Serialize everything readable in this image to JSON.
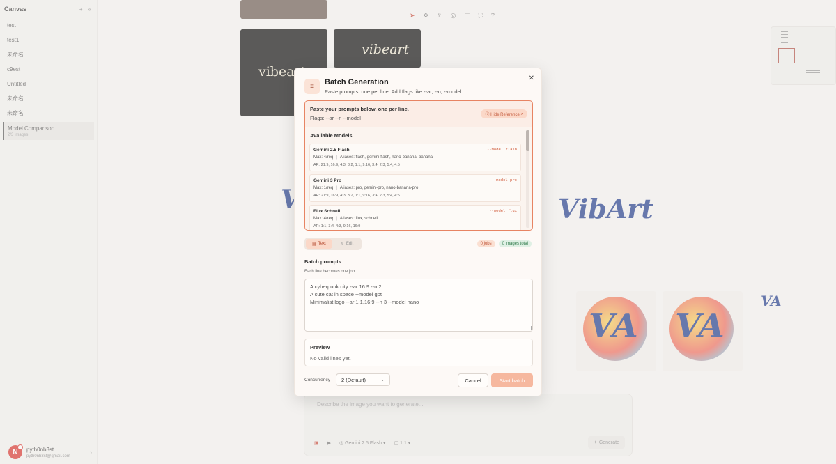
{
  "sidebar": {
    "title": "Canvas",
    "items": [
      {
        "label": "test",
        "sub": ""
      },
      {
        "label": "test1",
        "sub": ""
      },
      {
        "label": "未命名",
        "sub": ""
      },
      {
        "label": "c9est",
        "sub": ""
      },
      {
        "label": "Untitled",
        "sub": ""
      },
      {
        "label": "未命名",
        "sub": ""
      },
      {
        "label": "未命名",
        "sub": ""
      },
      {
        "label": "Model Comparison",
        "sub": "2/3 images"
      }
    ],
    "user": {
      "initial": "N",
      "name": "pyth0nb3st",
      "email": "pyth0nb3st@gmail.com"
    }
  },
  "canvas": {
    "tile_text_1": "vibeart",
    "tile_text_2": "vibeart",
    "vibart_logo": "VibArt",
    "va_logo": "VA",
    "prompt_placeholder": "Describe the image you want to generate...",
    "model_chip": "Gemini 2.5 Flash",
    "ratio_chip": "1:1",
    "generate_label": "Generate"
  },
  "modal": {
    "title": "Batch Generation",
    "subtitle": "Paste prompts, one per line. Add flags like --ar, --n, --model.",
    "reference": {
      "line1": "Paste your prompts below, one per line.",
      "line2": "Flags: --ar --n --model",
      "hide_label": "Hide Reference",
      "available_title": "Available Models",
      "models": [
        {
          "name": "Gemini 2.5 Flash",
          "flag": "--model flash",
          "max": "Max: 4/req",
          "aliases": "Aliases: flash, gemini-flash, nano-banana, banana",
          "ar": "AR: 21:9, 16:9, 4:3, 3:2, 1:1, 9:16, 3:4, 2:3, 5:4, 4:5"
        },
        {
          "name": "Gemini 3 Pro",
          "flag": "--model pro",
          "max": "Max: 1/req",
          "aliases": "Aliases: pro, gemini-pro, nano-banana-pro",
          "ar": "AR: 21:9, 16:9, 4:3, 3:2, 1:1, 9:16, 3:4, 2:3, 5:4, 4:5"
        },
        {
          "name": "Flux Schnell",
          "flag": "--model flux",
          "max": "Max: 4/req",
          "aliases": "Aliases: flux, schnell",
          "ar": "AR: 1:1, 3:4, 4:3, 9:16, 16:9"
        }
      ]
    },
    "modes": {
      "text": "Text",
      "edit": "Edit"
    },
    "jobs_badge": "0 jobs",
    "images_badge": "0 images total",
    "batch_label": "Batch prompts",
    "batch_hint": "Each line becomes one job.",
    "batch_value": "A cyberpunk city --ar 16:9 --n 2\nA cute cat in space --model gpt\nMinimalist logo --ar 1:1,16:9 --n 3 --model nano",
    "preview_title": "Preview",
    "preview_empty": "No valid lines yet.",
    "concurrency_label": "Concurrency",
    "concurrency_value": "2 (Default)",
    "cancel_label": "Cancel",
    "start_label": "Start batch"
  }
}
